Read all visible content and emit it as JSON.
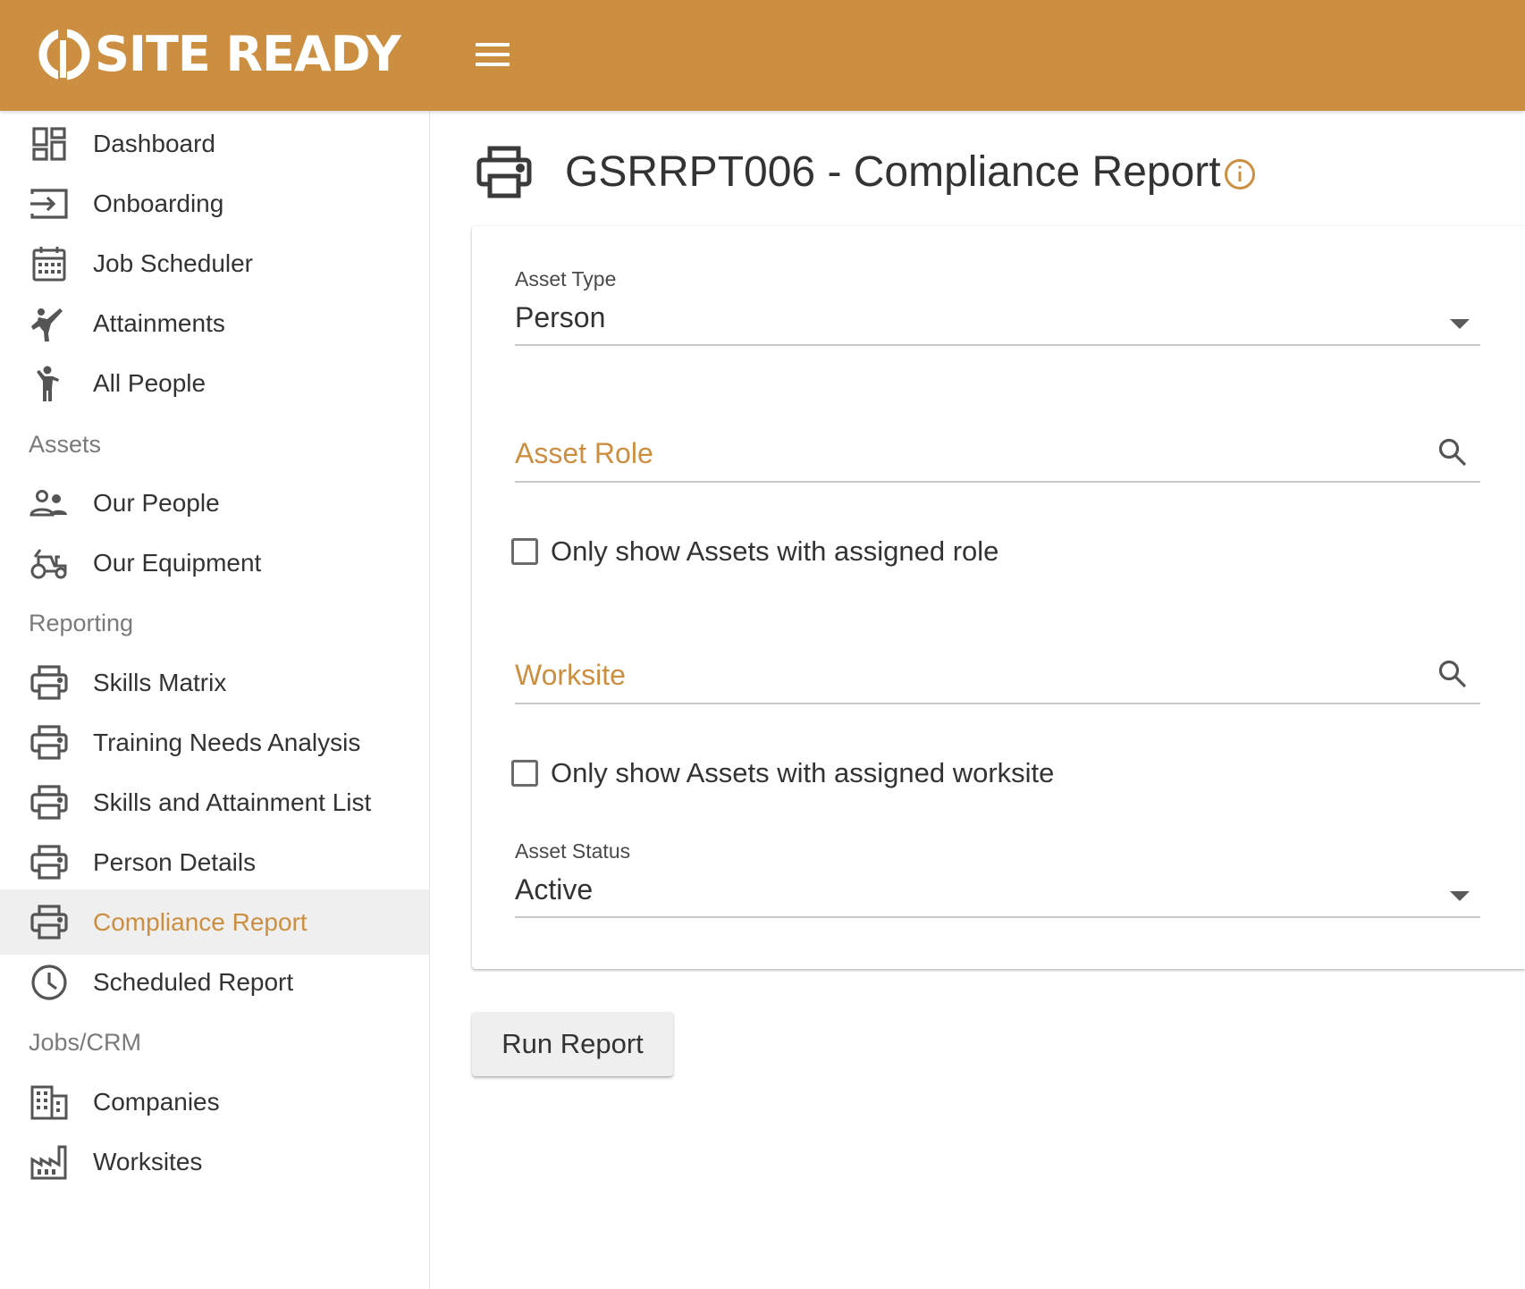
{
  "header": {
    "brand": "SITE READY",
    "menu_icon": "hamburger-menu-icon",
    "background_color": "#cc8f41"
  },
  "sidebar": {
    "items_top": [
      {
        "label": "Dashboard",
        "icon": "dashboard-icon"
      },
      {
        "label": "Onboarding",
        "icon": "login-icon"
      },
      {
        "label": "Job Scheduler",
        "icon": "calendar-icon"
      },
      {
        "label": "Attainments",
        "icon": "karate-icon"
      },
      {
        "label": "All People",
        "icon": "person-icon"
      }
    ],
    "sections": [
      {
        "title": "Assets",
        "items": [
          {
            "label": "Our People",
            "icon": "people-icon"
          },
          {
            "label": "Our Equipment",
            "icon": "tractor-icon"
          }
        ]
      },
      {
        "title": "Reporting",
        "items": [
          {
            "label": "Skills Matrix",
            "icon": "printer-icon"
          },
          {
            "label": "Training Needs Analysis",
            "icon": "printer-icon"
          },
          {
            "label": "Skills and Attainment List",
            "icon": "printer-icon"
          },
          {
            "label": "Person Details",
            "icon": "printer-icon"
          },
          {
            "label": "Compliance Report",
            "icon": "printer-icon",
            "active": true
          },
          {
            "label": "Scheduled Report",
            "icon": "clock-icon"
          }
        ]
      },
      {
        "title": "Jobs/CRM",
        "items": [
          {
            "label": "Companies",
            "icon": "building-icon"
          },
          {
            "label": "Worksites",
            "icon": "factory-icon"
          }
        ]
      }
    ],
    "active_color": "#cc8f41",
    "active_background": "#efefef"
  },
  "main": {
    "title": "GSRRPT006 - Compliance Report",
    "title_icon": "printer-icon",
    "info_icon": "info-icon",
    "form": {
      "asset_type": {
        "label": "Asset Type",
        "value": "Person"
      },
      "asset_role": {
        "placeholder": "Asset Role"
      },
      "assigned_role_checkbox": {
        "label": "Only show Assets with assigned role",
        "checked": false
      },
      "worksite": {
        "placeholder": "Worksite"
      },
      "assigned_worksite_checkbox": {
        "label": "Only show Assets with assigned worksite",
        "checked": false
      },
      "asset_status": {
        "label": "Asset Status",
        "value": "Active"
      }
    },
    "run_button_label": "Run Report"
  }
}
